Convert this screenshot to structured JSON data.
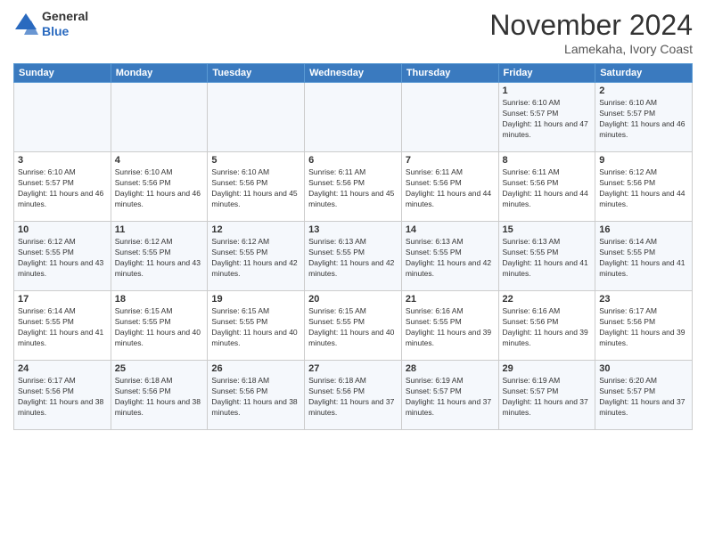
{
  "header": {
    "logo_line1": "General",
    "logo_line2": "Blue",
    "month_title": "November 2024",
    "location": "Lamekaha, Ivory Coast"
  },
  "days_of_week": [
    "Sunday",
    "Monday",
    "Tuesday",
    "Wednesday",
    "Thursday",
    "Friday",
    "Saturday"
  ],
  "weeks": [
    [
      {
        "day": "",
        "info": ""
      },
      {
        "day": "",
        "info": ""
      },
      {
        "day": "",
        "info": ""
      },
      {
        "day": "",
        "info": ""
      },
      {
        "day": "",
        "info": ""
      },
      {
        "day": "1",
        "info": "Sunrise: 6:10 AM\nSunset: 5:57 PM\nDaylight: 11 hours and 47 minutes."
      },
      {
        "day": "2",
        "info": "Sunrise: 6:10 AM\nSunset: 5:57 PM\nDaylight: 11 hours and 46 minutes."
      }
    ],
    [
      {
        "day": "3",
        "info": "Sunrise: 6:10 AM\nSunset: 5:57 PM\nDaylight: 11 hours and 46 minutes."
      },
      {
        "day": "4",
        "info": "Sunrise: 6:10 AM\nSunset: 5:56 PM\nDaylight: 11 hours and 46 minutes."
      },
      {
        "day": "5",
        "info": "Sunrise: 6:10 AM\nSunset: 5:56 PM\nDaylight: 11 hours and 45 minutes."
      },
      {
        "day": "6",
        "info": "Sunrise: 6:11 AM\nSunset: 5:56 PM\nDaylight: 11 hours and 45 minutes."
      },
      {
        "day": "7",
        "info": "Sunrise: 6:11 AM\nSunset: 5:56 PM\nDaylight: 11 hours and 44 minutes."
      },
      {
        "day": "8",
        "info": "Sunrise: 6:11 AM\nSunset: 5:56 PM\nDaylight: 11 hours and 44 minutes."
      },
      {
        "day": "9",
        "info": "Sunrise: 6:12 AM\nSunset: 5:56 PM\nDaylight: 11 hours and 44 minutes."
      }
    ],
    [
      {
        "day": "10",
        "info": "Sunrise: 6:12 AM\nSunset: 5:55 PM\nDaylight: 11 hours and 43 minutes."
      },
      {
        "day": "11",
        "info": "Sunrise: 6:12 AM\nSunset: 5:55 PM\nDaylight: 11 hours and 43 minutes."
      },
      {
        "day": "12",
        "info": "Sunrise: 6:12 AM\nSunset: 5:55 PM\nDaylight: 11 hours and 42 minutes."
      },
      {
        "day": "13",
        "info": "Sunrise: 6:13 AM\nSunset: 5:55 PM\nDaylight: 11 hours and 42 minutes."
      },
      {
        "day": "14",
        "info": "Sunrise: 6:13 AM\nSunset: 5:55 PM\nDaylight: 11 hours and 42 minutes."
      },
      {
        "day": "15",
        "info": "Sunrise: 6:13 AM\nSunset: 5:55 PM\nDaylight: 11 hours and 41 minutes."
      },
      {
        "day": "16",
        "info": "Sunrise: 6:14 AM\nSunset: 5:55 PM\nDaylight: 11 hours and 41 minutes."
      }
    ],
    [
      {
        "day": "17",
        "info": "Sunrise: 6:14 AM\nSunset: 5:55 PM\nDaylight: 11 hours and 41 minutes."
      },
      {
        "day": "18",
        "info": "Sunrise: 6:15 AM\nSunset: 5:55 PM\nDaylight: 11 hours and 40 minutes."
      },
      {
        "day": "19",
        "info": "Sunrise: 6:15 AM\nSunset: 5:55 PM\nDaylight: 11 hours and 40 minutes."
      },
      {
        "day": "20",
        "info": "Sunrise: 6:15 AM\nSunset: 5:55 PM\nDaylight: 11 hours and 40 minutes."
      },
      {
        "day": "21",
        "info": "Sunrise: 6:16 AM\nSunset: 5:55 PM\nDaylight: 11 hours and 39 minutes."
      },
      {
        "day": "22",
        "info": "Sunrise: 6:16 AM\nSunset: 5:56 PM\nDaylight: 11 hours and 39 minutes."
      },
      {
        "day": "23",
        "info": "Sunrise: 6:17 AM\nSunset: 5:56 PM\nDaylight: 11 hours and 39 minutes."
      }
    ],
    [
      {
        "day": "24",
        "info": "Sunrise: 6:17 AM\nSunset: 5:56 PM\nDaylight: 11 hours and 38 minutes."
      },
      {
        "day": "25",
        "info": "Sunrise: 6:18 AM\nSunset: 5:56 PM\nDaylight: 11 hours and 38 minutes."
      },
      {
        "day": "26",
        "info": "Sunrise: 6:18 AM\nSunset: 5:56 PM\nDaylight: 11 hours and 38 minutes."
      },
      {
        "day": "27",
        "info": "Sunrise: 6:18 AM\nSunset: 5:56 PM\nDaylight: 11 hours and 37 minutes."
      },
      {
        "day": "28",
        "info": "Sunrise: 6:19 AM\nSunset: 5:57 PM\nDaylight: 11 hours and 37 minutes."
      },
      {
        "day": "29",
        "info": "Sunrise: 6:19 AM\nSunset: 5:57 PM\nDaylight: 11 hours and 37 minutes."
      },
      {
        "day": "30",
        "info": "Sunrise: 6:20 AM\nSunset: 5:57 PM\nDaylight: 11 hours and 37 minutes."
      }
    ]
  ]
}
